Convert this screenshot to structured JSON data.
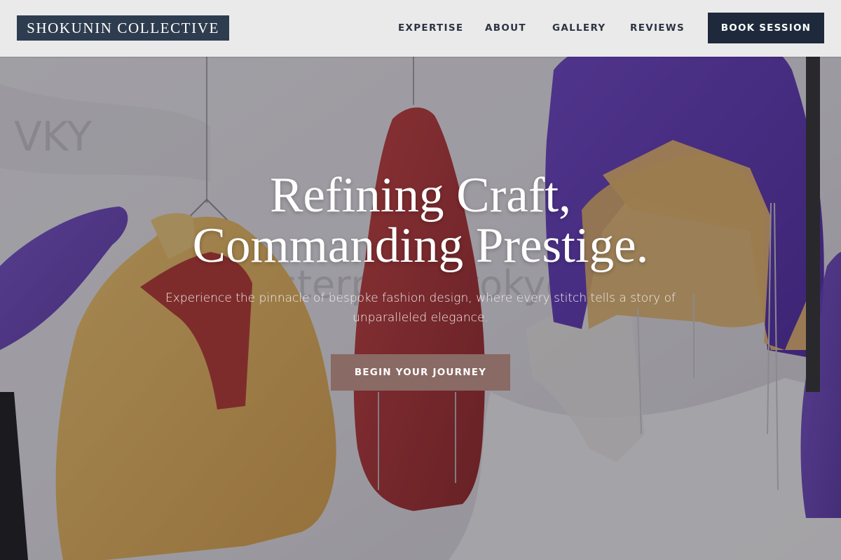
{
  "brand": {
    "name": "SHOKUNIN COLLECTIVE"
  },
  "nav": {
    "links": [
      "EXPERTISE",
      "ABOUT",
      "GALLERY",
      "REVIEWS"
    ],
    "cta": "BOOK SESSION"
  },
  "hero": {
    "title_line1": "Refining Craft,",
    "title_line2": "Commanding Prestige.",
    "subtitle": "Experience the pinnacle of bespoke fashion design, where every stitch tells a story of unparalleled elegance.",
    "cta": "BEGIN YOUR JOURNEY",
    "background": "hanging-garments-photo"
  },
  "colors": {
    "header_bg": "#eaeaeb",
    "brand_bg": "#2e3c4f",
    "nav_text": "#2c3442",
    "book_btn_bg": "#1e2a3b",
    "cta_bg": "#8a6a64"
  }
}
